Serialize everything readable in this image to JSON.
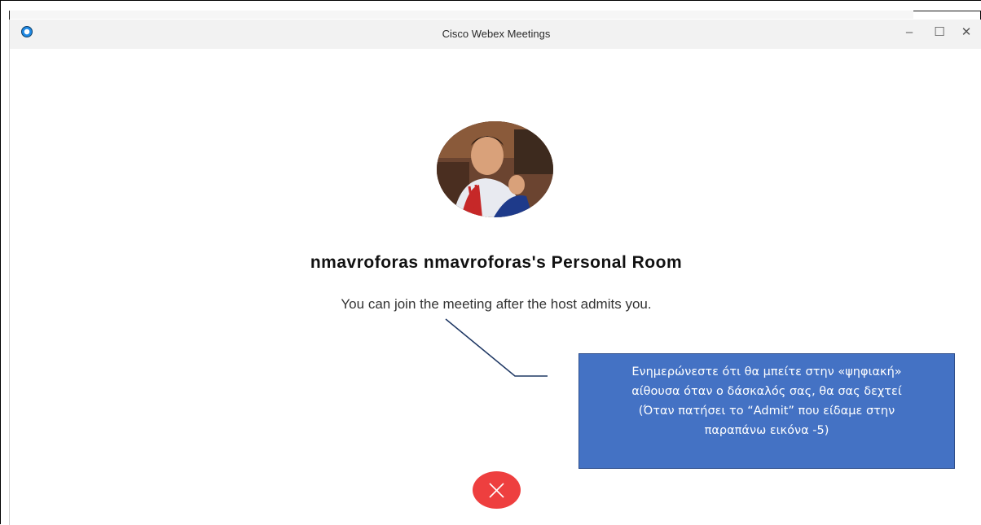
{
  "window": {
    "title": "Cisco Webex Meetings",
    "controls": {
      "minimize": "–",
      "maximize": "☐",
      "close": "✕"
    },
    "app_icon": "webex-logo-icon"
  },
  "meeting": {
    "room_title": "nmavroforas nmavroforas's Personal Room",
    "status_message": "You can join the meeting after the host admits you.",
    "leave_button_icon": "close-icon",
    "leave_button_color": "#ee3f3f"
  },
  "annotation": {
    "lines": [
      "Ενημερώνεστε ότι θα μπείτε στην «ψηφιακή»",
      "αίθουσα όταν ο δάσκαλός σας, θα σας δεχτεί",
      "(Όταν πατήσει το “Admit” που είδαμε στην",
      "παραπάνω εικόνα -5)"
    ],
    "box_color": "#4472c4",
    "line_color": "#1f3864"
  }
}
